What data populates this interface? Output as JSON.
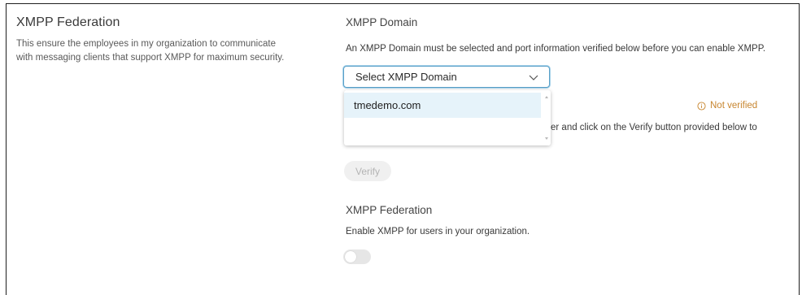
{
  "left": {
    "title": "XMPP Federation",
    "description": "This ensure the employees in my organization to communicate with messaging clients that support XMPP for maximum security."
  },
  "domain_section": {
    "heading": "XMPP Domain",
    "description": "An XMPP Domain must be selected and port information verified below before you can enable XMPP.",
    "select": {
      "selected_label": "Select XMPP Domain",
      "options": [
        "tmedemo.com"
      ]
    },
    "status": "Not verified",
    "partial_instruction": "er and click on the Verify button provided below to",
    "verify_label": "Verify"
  },
  "federation_section": {
    "heading": "XMPP Federation",
    "description": "Enable XMPP for users in your organization.",
    "toggle_on": false
  },
  "colors": {
    "focus_border": "#5aa0c8",
    "option_highlight": "#e6f3fa",
    "warning": "#c7852e"
  }
}
